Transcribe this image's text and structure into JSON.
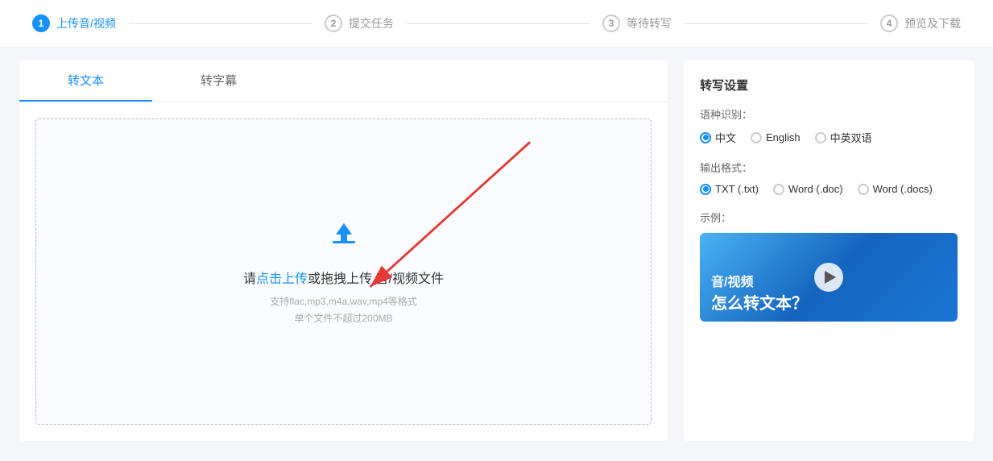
{
  "stepper": {
    "steps": [
      {
        "num": "1",
        "label": "上传音/视频",
        "active": true
      },
      {
        "num": "2",
        "label": "提交任务",
        "active": false
      },
      {
        "num": "3",
        "label": "等待转写",
        "active": false
      },
      {
        "num": "4",
        "label": "预览及下载",
        "active": false
      }
    ]
  },
  "tabs": [
    {
      "label": "转文本",
      "active": true
    },
    {
      "label": "转字幕",
      "active": false
    }
  ],
  "upload": {
    "link_text": "点击上传",
    "text_before": "请",
    "text_after": "或拖拽上传 音/视频文件",
    "hint_line1": "支持flac,mp3,m4a,wav,mp4等格式",
    "hint_line2": "单个文件不超过200MB"
  },
  "settings": {
    "title": "转写设置",
    "lang_label": "语种识别：",
    "lang_options": [
      {
        "label": "中文",
        "checked": true
      },
      {
        "label": "English",
        "checked": false
      },
      {
        "label": "中英双语",
        "checked": false
      }
    ],
    "format_label": "输出格式：",
    "format_options": [
      {
        "label": "TXT (.txt)",
        "checked": true
      },
      {
        "label": "Word (.doc)",
        "checked": false
      },
      {
        "label": "Word (.docs)",
        "checked": false
      }
    ],
    "example_label": "示例：",
    "video_text_top": "音/视频",
    "video_text_bottom": "怎么转文本？"
  }
}
